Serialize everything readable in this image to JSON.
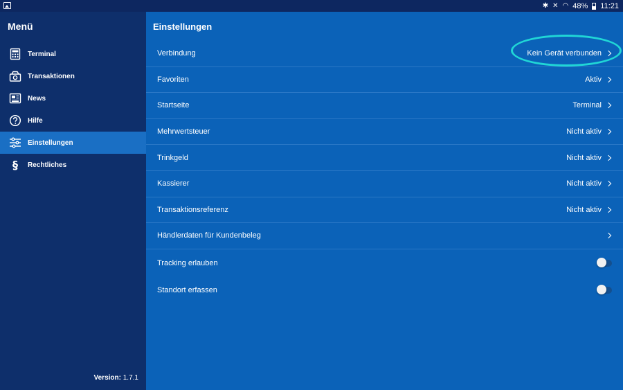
{
  "statusbar": {
    "battery": "48%",
    "time": "11:21"
  },
  "sidebar": {
    "title": "Menü",
    "items": [
      {
        "label": "Terminal",
        "icon": "calculator-icon"
      },
      {
        "label": "Transaktionen",
        "icon": "cash-register-icon"
      },
      {
        "label": "News",
        "icon": "newspaper-icon"
      },
      {
        "label": "Hilfe",
        "icon": "help-icon"
      },
      {
        "label": "Einstellungen",
        "icon": "sliders-icon",
        "active": true
      },
      {
        "label": "Rechtliches",
        "icon": "paragraph-icon"
      }
    ],
    "version_label": "Version:",
    "version_value": "1.7.1"
  },
  "main": {
    "title": "Einstellungen",
    "rows": [
      {
        "label": "Verbindung",
        "value": "Kein Gerät verbunden"
      },
      {
        "label": "Favoriten",
        "value": "Aktiv"
      },
      {
        "label": "Startseite",
        "value": "Terminal"
      },
      {
        "label": "Mehrwertsteuer",
        "value": "Nicht aktiv"
      },
      {
        "label": "Trinkgeld",
        "value": "Nicht aktiv"
      },
      {
        "label": "Kassierer",
        "value": "Nicht aktiv"
      },
      {
        "label": "Transaktionsreferenz",
        "value": "Nicht aktiv"
      },
      {
        "label": "Händlerdaten für Kundenbeleg",
        "value": ""
      }
    ],
    "toggles": [
      {
        "label": "Tracking erlauben",
        "on": false
      },
      {
        "label": "Standort erfassen",
        "on": false
      }
    ]
  },
  "colors": {
    "sidebar_bg": "#0e2f6b",
    "main_bg": "#0b62b8",
    "active_item": "#1a6fc4",
    "highlight": "#20d6d6"
  }
}
